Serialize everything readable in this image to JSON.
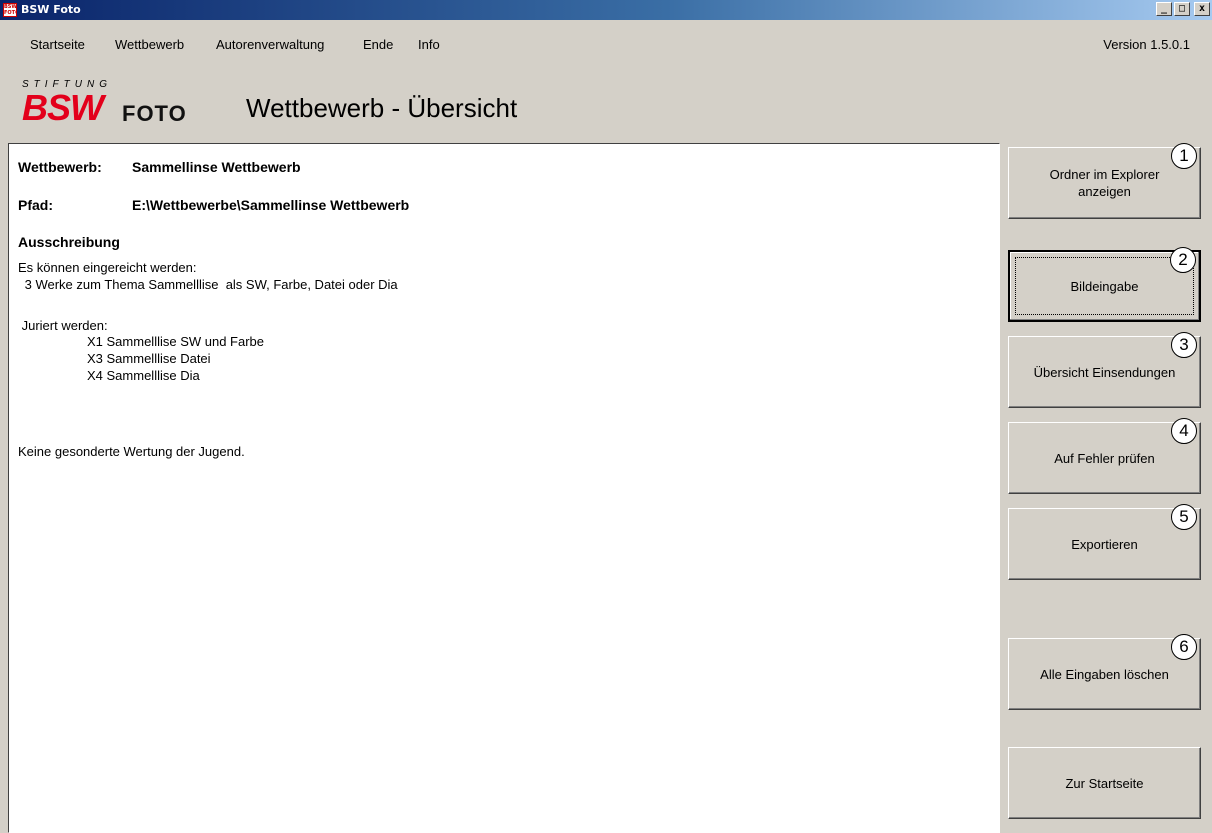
{
  "window": {
    "icon_text": "BSW FOTO",
    "title": "BSW Foto",
    "minimize": "_",
    "maximize": "□",
    "close": "x"
  },
  "menu": {
    "items": [
      "Startseite",
      "Wettbewerb",
      "Autorenverwaltung",
      "Ende",
      "Info"
    ],
    "version": "Version 1.5.0.1"
  },
  "header": {
    "logo_stiftung": "STIFTUNG",
    "logo_bsw": "BSW",
    "logo_foto": "FOTO",
    "title": "Wettbewerb - Übersicht"
  },
  "details": {
    "wettbewerb_label": "Wettbewerb:",
    "wettbewerb_value": "Sammellinse Wettbewerb",
    "pfad_label": "Pfad:",
    "pfad_value": "E:\\Wettbewerbe\\Sammellinse Wettbewerb",
    "ausschreibung_heading": "Ausschreibung",
    "lines": [
      "Es können eingereicht werden:",
      " 3 Werke zum Thema Sammelllise  als SW, Farbe, Datei oder Dia",
      " Juriert werden:",
      "X1 Sammelllise SW und Farbe",
      "X3 Sammelllise Datei",
      "X4 Sammelllise Dia",
      "Keine gesonderte Wertung der Jugend."
    ]
  },
  "buttons": [
    {
      "num": "1",
      "label": "Ordner im Explorer anzeigen"
    },
    {
      "num": "2",
      "label": "Bildeingabe"
    },
    {
      "num": "3",
      "label": "Übersicht Einsendungen"
    },
    {
      "num": "4",
      "label": "Auf Fehler prüfen"
    },
    {
      "num": "5",
      "label": "Exportieren"
    },
    {
      "num": "6",
      "label": "Alle Eingaben löschen"
    },
    {
      "num": "",
      "label": "Zur Startseite"
    }
  ],
  "colors": {
    "brand_red": "#e3001b",
    "titlebar_start": "#0a246a",
    "titlebar_end": "#a6caf0"
  }
}
